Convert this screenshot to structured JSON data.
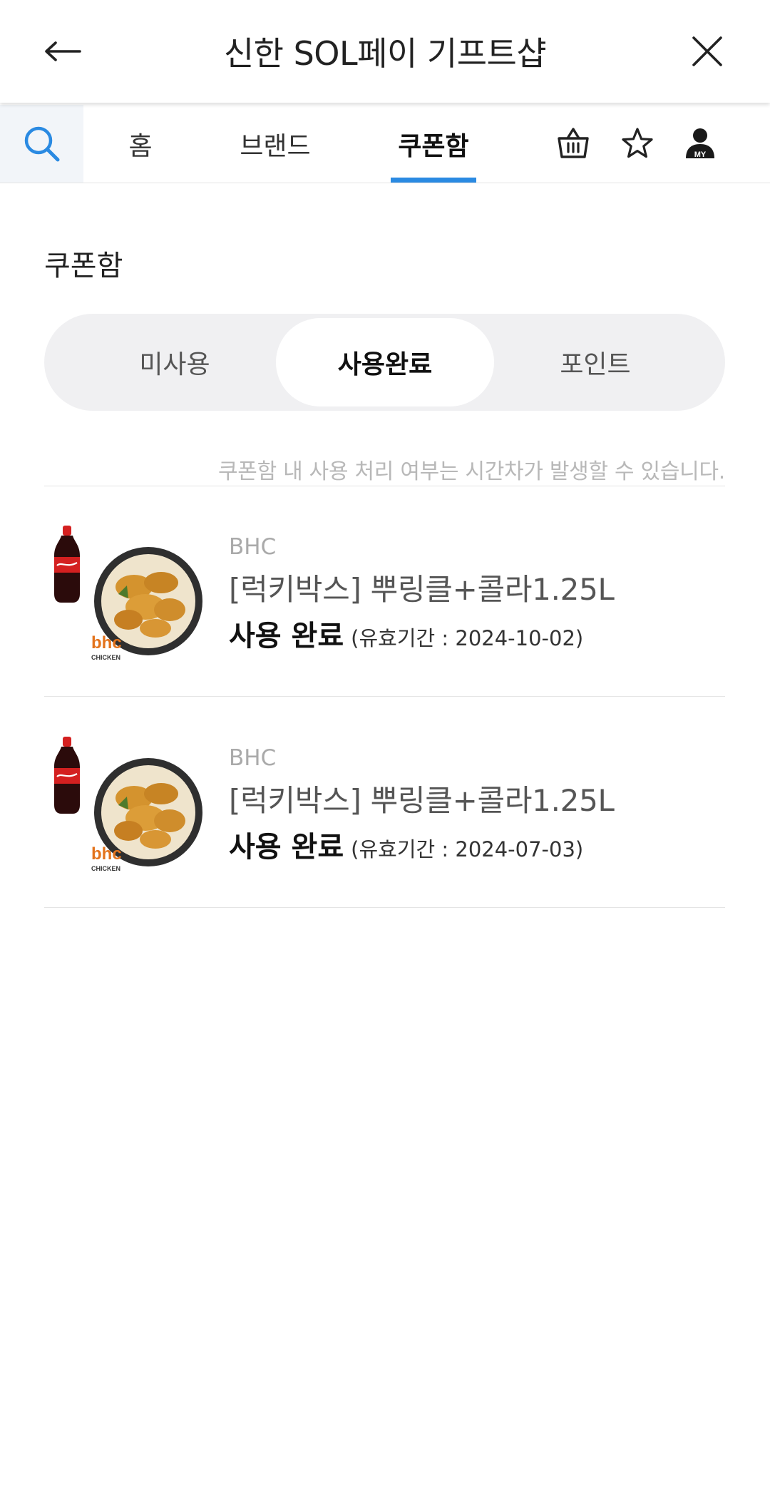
{
  "header": {
    "title": "신한 SOL페이 기프트샵",
    "back_icon": "arrow-left-icon",
    "close_icon": "close-icon"
  },
  "nav": {
    "tabs": [
      {
        "label": "홈"
      },
      {
        "label": "브랜드"
      },
      {
        "label": "쿠폰함",
        "active": true
      }
    ],
    "my_badge": "MY",
    "accent_color": "#2a8ae2"
  },
  "page": {
    "section_title": "쿠폰함",
    "segments": [
      {
        "label": "미사용"
      },
      {
        "label": "사용완료",
        "active": true
      },
      {
        "label": "포인트"
      }
    ],
    "notice": "쿠폰함 내 사용 처리 여부는 시간차가 발생할 수 있습니다."
  },
  "coupons": [
    {
      "brand": "BHC",
      "name": "[럭키박스] 뿌링클+콜라1.25L",
      "status": "사용 완료",
      "expiry": "(유효기간 : 2024-10-02)",
      "thumb_text": "bhc",
      "thumb_sub": "CHICKEN"
    },
    {
      "brand": "BHC",
      "name": "[럭키박스] 뿌링클+콜라1.25L",
      "status": "사용 완료",
      "expiry": "(유효기간 : 2024-07-03)",
      "thumb_text": "bhc",
      "thumb_sub": "CHICKEN"
    }
  ]
}
